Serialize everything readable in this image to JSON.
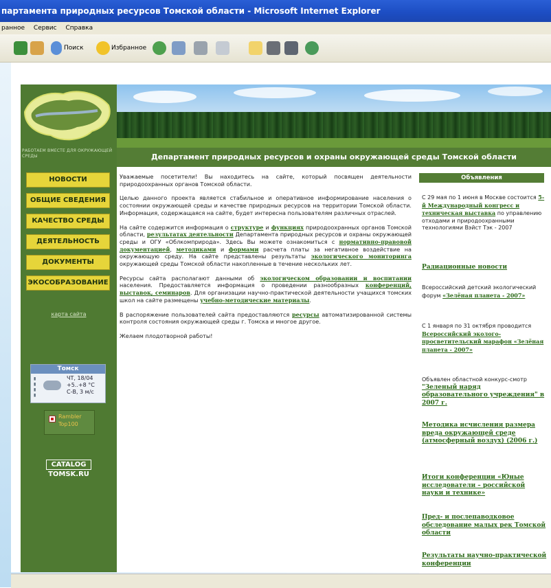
{
  "browser": {
    "title": "партамента природных ресурсов Томской области - Microsoft Internet Explorer",
    "menu": [
      "ранное",
      "Сервис",
      "Справка"
    ],
    "toolbar": {
      "search": "Поиск",
      "favorites": "Избранное"
    }
  },
  "site": {
    "left_tagline": "РАБОТАЕМ ВМЕСТЕ ДЛЯ ОКРУЖАЮЩЕЙ СРЕДЫ",
    "header_title": "Департамент природных ресурсов и охраны окружающей среды Томской области",
    "nav": [
      "НОВОСТИ",
      "ОБЩИЕ СВЕДЕНИЯ",
      "КАЧЕСТВО СРЕДЫ",
      "ДЕЯТЕЛЬНОСТЬ",
      "ДОКУМЕНТЫ",
      "ЭКОСОБРАЗОВАНИЕ"
    ],
    "sitemap": "карта сайта",
    "weather": {
      "city": "Томск",
      "line1": "ЧТ, 18/04",
      "line2": "+5..+8 °C",
      "line3": "С-В, 3 м/с"
    },
    "rambler": {
      "line1": "Rambler",
      "line2": "Top100"
    },
    "catalog": {
      "line1": "CATALOG",
      "line2": "TOMSK.RU"
    }
  },
  "main": {
    "p1": "Уважаемые посетители! Вы находитесь на сайте, который посвящен деятельности природоохранных органов Томской области.",
    "p2": "Целью данного проекта является стабильное и оперативное информирование населения о состоянии окружающей среды и качестве природных ресурсов на территории Томской области. Информация, содержащаяся на сайте, будет интересна пользователям различных отраслей.",
    "p3a": "На сайте содержится информация о",
    "l_structure": "структуре",
    "p3b": "и",
    "l_functions": "функциях",
    "p3c": "природоохранных органов Томской области,",
    "l_results": "результатах деятельности",
    "p3d": "Департамента природных ресурсов и охраны окружающей среды и ОГУ «Облкомприрода». Здесь Вы можете ознакомиться с",
    "l_norm": "нормативно-правовой документацией",
    "p3e": ",",
    "l_methods": "методиками",
    "p3f": "и",
    "l_forms": "формами",
    "p3g": "расчета платы за негативное воздействие на окружающую среду. На сайте представлены результаты",
    "l_monitoring": "экологического мониторинга",
    "p3h": "окружающей среды Томской области накопленные в течение нескольких лет.",
    "p4a": "Ресурсы сайта располагают данными об",
    "l_education": "экологическом образовании и воспитании",
    "p4b": "населения. Предоставляется информация о проведении разнообразных",
    "l_conferences": "конференций, выставок, семинаров",
    "p4c": ". Для организации научно-практической деятельности учащихся томских школ на сайте размещены",
    "l_materials": "учебно-методические материалы",
    "p4d": ".",
    "p5a": "В распоряжение пользователей сайта предоставляются",
    "l_resources": "ресурсы",
    "p5b": "автоматизированной системы контроля состояния окружающей среды г. Томска и многое другое.",
    "p6": "Желаем плодотворной работы!"
  },
  "right": {
    "heading": "Объявления",
    "i1a": "С 29 мая по 1 июня в Москве состоится",
    "i1l": "5-й Международный конгресс и техническая выставка",
    "i1b": "по управлению отходами и природоохранными технологиями Вэйст Тэк - 2007",
    "i2l": "Радиационные новости",
    "i3a": "Всероссийский детский экологический форум",
    "i3l": "«Зелёная планета - 2007»",
    "i4a": "С 1 января по 31 октября проводится",
    "i4l": "Всероссийский эколого-просветительский марафон «Зелёная планета - 2007»",
    "i5a": "Объявлен областной конкурс-смотр",
    "i5l": "\"Зеленый наряд образовательного учреждения\" в 2007 г.",
    "i6l": "Методика исчисления размера вреда окружающей среде (атмосферный воздух) (2006 г.)",
    "i7l": "Итоги конференции «Юные исследователи – российской науки и технике»",
    "i8l": "Пред- и послепаводковое обследование малых рек Томской области",
    "i9l": "Результаты научно-практической конференции"
  }
}
